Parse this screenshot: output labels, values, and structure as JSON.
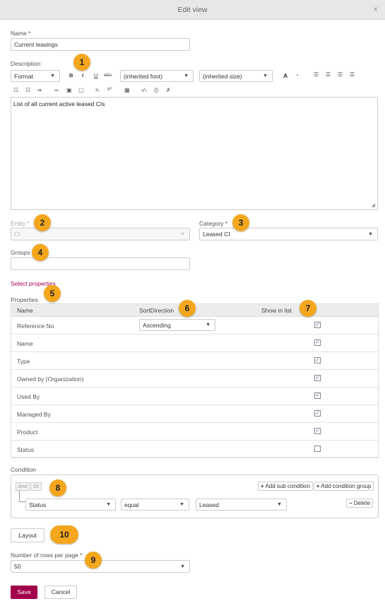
{
  "window": {
    "title": "Edit view",
    "close_glyph": "×"
  },
  "form": {
    "name_label": "Name *",
    "name_value": "Current leasings",
    "description_label": "Description",
    "toolbar": {
      "format_label": "Format",
      "bold": "B",
      "italic": "I",
      "underline": "U",
      "strike": "abc",
      "font_value": "(inherited font)",
      "size_value": "(inherited size)",
      "text_color": "A",
      "subscript": "x₂",
      "superscript": "x²"
    },
    "description_text": "List of all current active leased CIs",
    "entity_label": "Entity *",
    "entity_value": "CI",
    "category_label": "Category *",
    "category_value": "Leased CI",
    "groups_label": "Groups",
    "groups_value": "",
    "select_properties_link": "Select properties",
    "properties_label": "Properties",
    "properties_columns": [
      "Name",
      "SortDirection",
      "Show in list"
    ],
    "properties_rows": [
      {
        "name": "Reference No",
        "sort": "Ascending",
        "checked": true
      },
      {
        "name": "Name",
        "sort": "",
        "checked": true
      },
      {
        "name": "Type",
        "sort": "",
        "checked": true
      },
      {
        "name": "Owned by (Organization)",
        "sort": "",
        "checked": true
      },
      {
        "name": "Used By",
        "sort": "",
        "checked": true
      },
      {
        "name": "Managed By",
        "sort": "",
        "checked": true
      },
      {
        "name": "Product",
        "sort": "",
        "checked": true
      },
      {
        "name": "Status",
        "sort": "",
        "checked": false
      }
    ],
    "condition_label": "Condition",
    "condition": {
      "and_label": "And",
      "or_label": "Or",
      "add_sub_condition": "Add sub condition",
      "add_condition_group": "Add condition group",
      "field": "Status",
      "operator": "equal",
      "value": "Leased",
      "delete_label": "Delete"
    },
    "layout_button": "Layout",
    "rows_per_page_label": "Number of rows per page *",
    "rows_per_page_value": "50",
    "save_button": "Save",
    "cancel_button": "Cancel"
  },
  "badges": [
    "1",
    "2",
    "3",
    "4",
    "5",
    "6",
    "7",
    "8",
    "9",
    "10"
  ],
  "colors": {
    "accent": "#a3004c",
    "badge": "#f4a61d",
    "header_bg": "#ececec"
  }
}
